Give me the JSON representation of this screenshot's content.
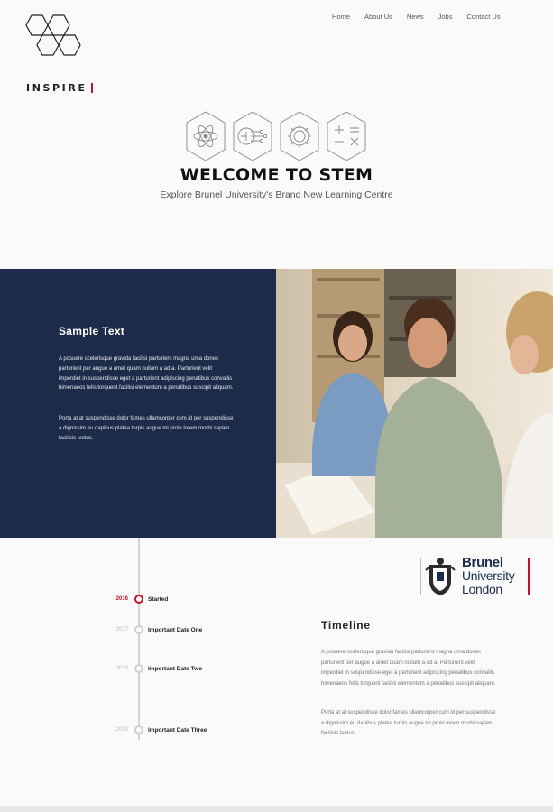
{
  "header": {
    "logo_text": "INSPIRE",
    "nav": [
      "Home",
      "About Us",
      "News",
      "Jobs",
      "Contact Us"
    ]
  },
  "hero": {
    "icons": [
      "atom-icon",
      "circuit-icon",
      "gear-icon",
      "math-symbols-icon"
    ],
    "title": "WELCOME TO STEM",
    "subtitle": "Explore Brunel University's Brand New Learning Centre"
  },
  "band": {
    "title": "Sample Text",
    "paragraph1": "A posuere scelerisque gravida facilisi parturient magna urna donec parturient per augue a amet quam nullam a ad a. Parturient velit imperdiet in suspendisse eget a parturient adipiscing penatibus convallis himenaeos felis torquent facilisi elementum a penatibus suscipit aliquam.",
    "paragraph2": "Porta at at suspendisse dolor fames ullamcorper cum id per suspendisse a dignissim eu dapibus platea turpis augue mi proin lorem morbi sapien facilisis lectus."
  },
  "timeline": {
    "items": [
      {
        "year": "2016",
        "label": "Started",
        "active": true
      },
      {
        "year": "2017",
        "label": "Important Date One",
        "active": false
      },
      {
        "year": "2018",
        "label": "Important Date Two",
        "active": false
      },
      {
        "year": "2020",
        "label": "Important Date Three",
        "active": false
      }
    ],
    "heading": "Timeline",
    "paragraph1": "A posuere scelerisque gravida facilisi parturient magna urna donec parturient per augue a amet quam nullam a ad a. Parturient velit imperdiet in suspendisse eget a parturient adipiscing penatibus convallis himenaeos felis torquent facilisi elementum a penatibus suscipit aliquam.",
    "paragraph2": "Porta at at suspendisse dolor fames ullamcorper cum id per suspendisse a dignissim eu dapibus platea turpis augue mi proin lorem morbi sapien facilisis lectus."
  },
  "brunel": {
    "line1": "Brunel",
    "line2": "University",
    "line3": "London"
  },
  "colors": {
    "navy": "#1c2b4a",
    "accent_red": "#c8102e"
  }
}
